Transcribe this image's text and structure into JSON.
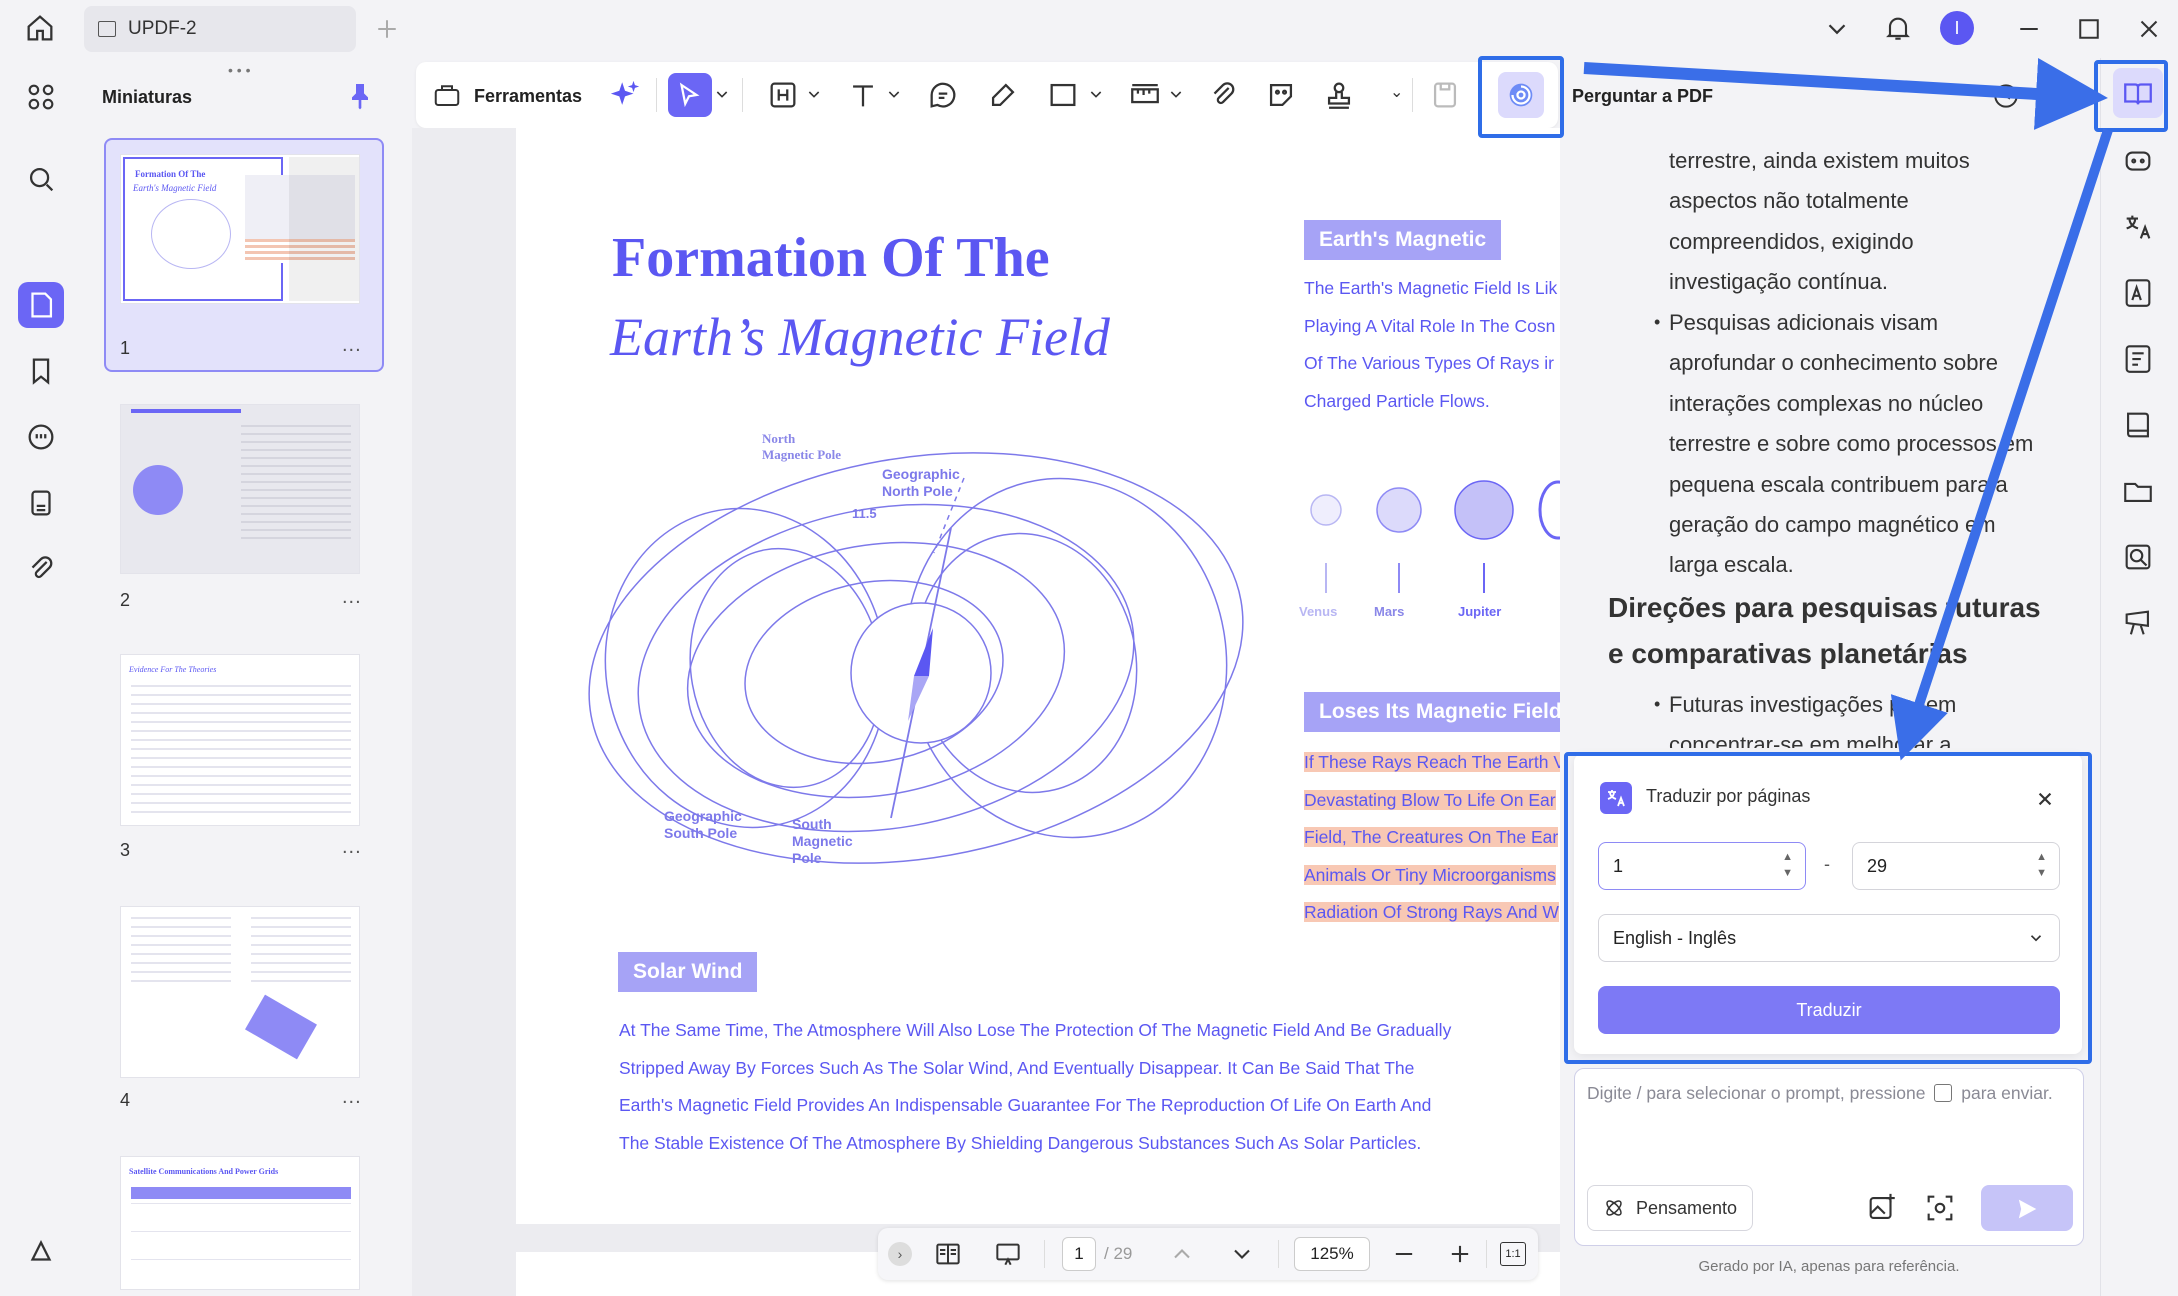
{
  "titlebar": {
    "tab_title": "UPDF-2",
    "avatar_initial": "I"
  },
  "thumbnails": {
    "title": "Miniaturas",
    "pages": [
      {
        "num": "1",
        "dots": "..."
      },
      {
        "num": "2",
        "dots": "..."
      },
      {
        "num": "3",
        "dots": "..."
      },
      {
        "num": "4",
        "dots": "..."
      }
    ],
    "thumb3_title": "Evidence For The Theories",
    "thumb5_title": "Satellite Communications And Power Grids"
  },
  "toolbar": {
    "tools_label": "Ferramentas"
  },
  "document": {
    "title_line1": "Formation Of The",
    "title_line2": "Earth’s Magnetic Field",
    "section_magnetic": "Earth's Magnetic",
    "magnetic_lines": [
      "The Earth's Magnetic Field Is Lik",
      "Playing A Vital Role In The Cosn",
      "Of The Various Types Of Rays ir",
      "Charged Particle Flows."
    ],
    "planets": [
      "Venus",
      "Mars",
      "Jupiter"
    ],
    "section_loses": "Loses Its Magnetic Field",
    "loses_lines": [
      "If These Rays Reach The Earth V",
      "Devastating Blow To Life On Ear",
      "Field, The Creatures On The Ear",
      "Animals Or Tiny Microorganisms",
      "Radiation Of Strong Rays And W"
    ],
    "diagram": {
      "north_magnetic": [
        "North",
        "Magnetic Pole"
      ],
      "geo_north": [
        "Geographic",
        "North Pole"
      ],
      "angle": "11.5",
      "geo_south": [
        "Geographic",
        "South Pole"
      ],
      "south_magnetic": [
        "South",
        "Magnetic",
        "Pole"
      ]
    },
    "section_solar": "Solar Wind",
    "solar_lines": [
      "At The Same Time, The Atmosphere Will Also Lose The Protection Of The Magnetic Field And Be Gradually",
      "Stripped Away By Forces Such As The Solar Wind, And Eventually Disappear. It Can Be Said That The",
      "Earth's Magnetic Field Provides An Indispensable Guarantee For The Reproduction Of Life On Earth And",
      "The Stable Existence Of The Atmosphere By Shielding Dangerous Substances Such As Solar Particles."
    ]
  },
  "bottom_nav": {
    "current_page": "1",
    "total_pages": "/ 29",
    "zoom": "125%"
  },
  "ask_pdf": {
    "title": "Perguntar a PDF",
    "chat_lines": [
      {
        "text": "terrestre, ainda existem muitos",
        "bullet": false
      },
      {
        "text": "aspectos não totalmente",
        "bullet": false
      },
      {
        "text": "compreendidos, exigindo",
        "bullet": false
      },
      {
        "text": "investigação contínua.",
        "bullet": false
      },
      {
        "text": "Pesquisas adicionais visam",
        "bullet": true
      },
      {
        "text": "aprofundar o conhecimento sobre",
        "bullet": false
      },
      {
        "text": "interações complexas no núcleo",
        "bullet": false
      },
      {
        "text": "terrestre e sobre como processos em",
        "bullet": false
      },
      {
        "text": "pequena escala contribuem para a",
        "bullet": false
      },
      {
        "text": "geração do campo magnético em",
        "bullet": false
      },
      {
        "text": "larga escala.",
        "bullet": false
      }
    ],
    "heading_line1": "Direções para pesquisas futuras",
    "heading_line2": "e comparativas planetárias",
    "chat_tail": [
      {
        "text": "Futuras investigações podem",
        "bullet": true
      },
      {
        "text": "concentrar-se em melhorar a",
        "bullet": false
      }
    ],
    "bullet_char": "•",
    "translate": {
      "title": "Traduzir por páginas",
      "from_page": "1",
      "dash": "-",
      "to_page": "29",
      "language": "English - Inglês",
      "button": "Traduzir"
    },
    "prompt_placeholder_pre": "Digite / para selecionar o prompt, pressione",
    "prompt_placeholder_post": "para enviar.",
    "thinking_button": "Pensamento",
    "footnote": "Gerado por IA, apenas para referência."
  },
  "colors": {
    "accent": "#5b57f2",
    "highlight_box": "#2f6de8",
    "pill": "#a6a3f6",
    "text_highlight": "#f8c8b4"
  }
}
